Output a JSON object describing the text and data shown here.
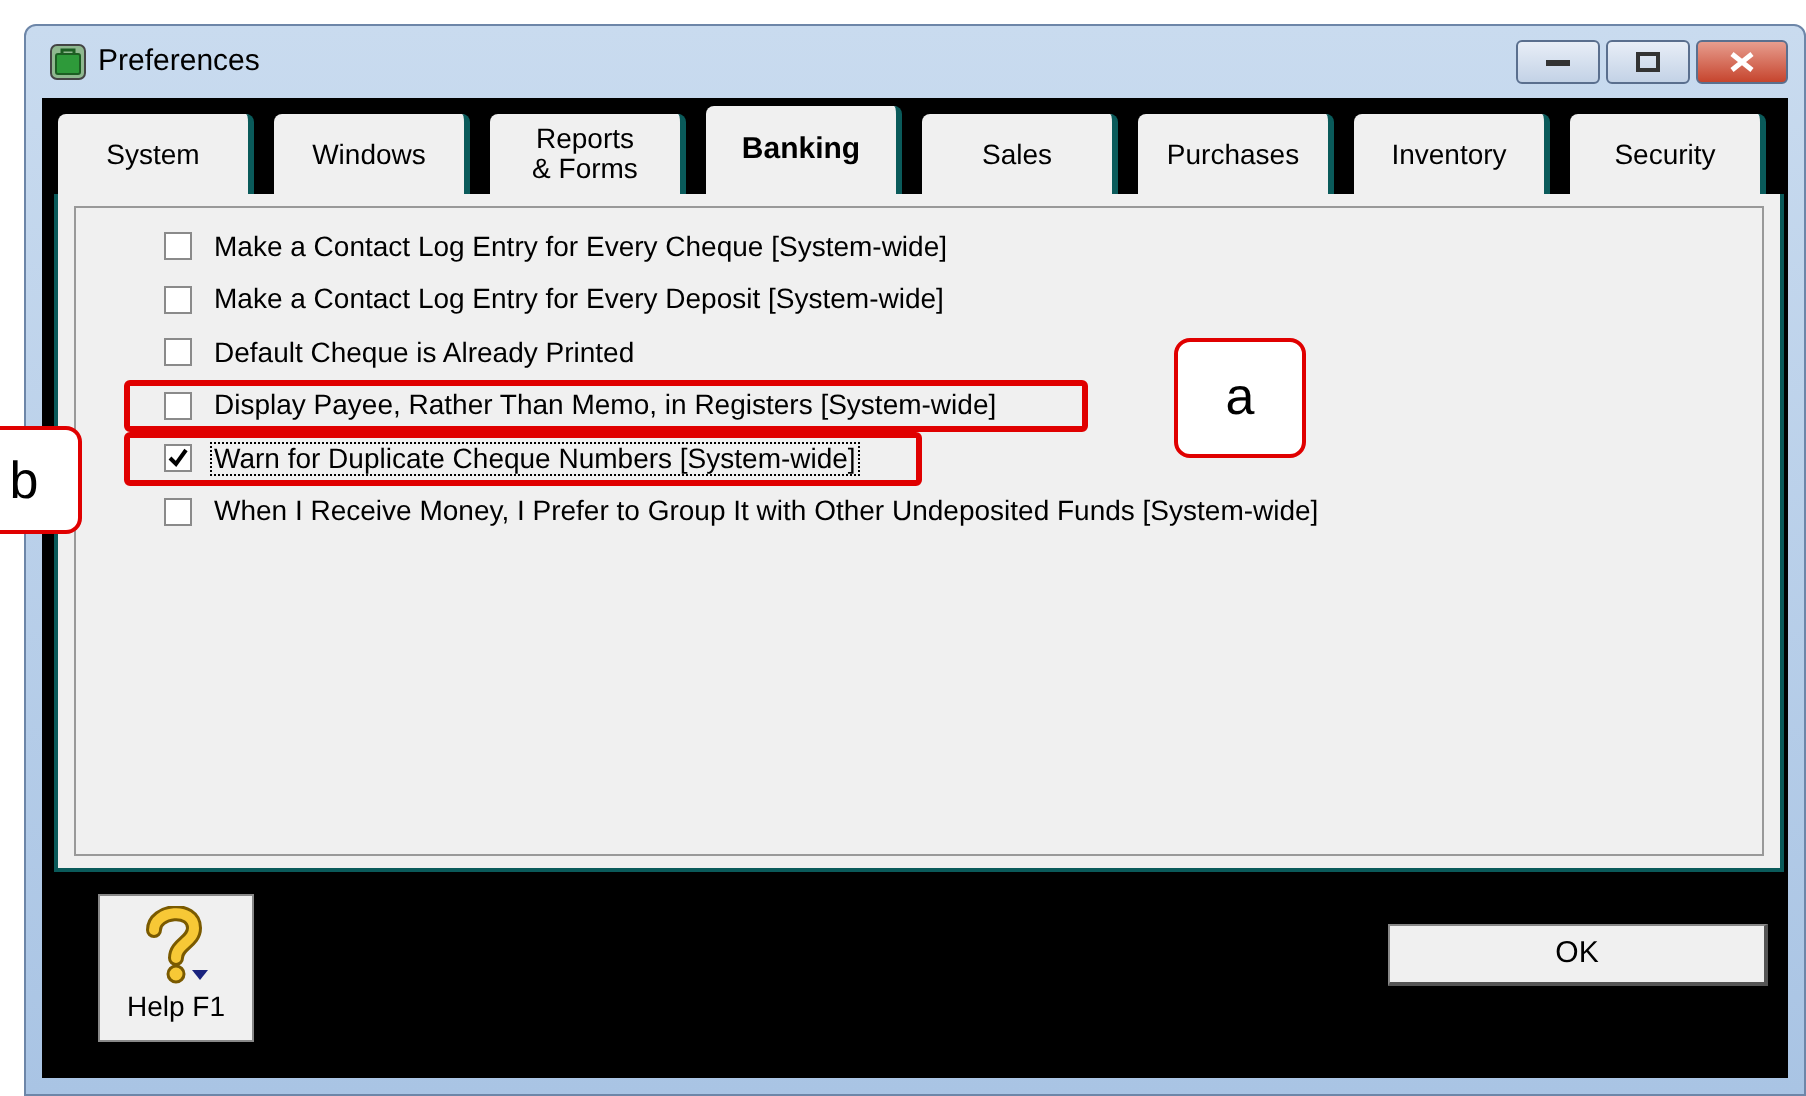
{
  "window": {
    "title": "Preferences"
  },
  "tabs": [
    {
      "label": "System",
      "selected": false
    },
    {
      "label": "Windows",
      "selected": false
    },
    {
      "label": "Reports\n& Forms",
      "selected": false
    },
    {
      "label": "Banking",
      "selected": true
    },
    {
      "label": "Sales",
      "selected": false
    },
    {
      "label": "Purchases",
      "selected": false
    },
    {
      "label": "Inventory",
      "selected": false
    },
    {
      "label": "Security",
      "selected": false
    }
  ],
  "options": [
    {
      "label": "Make a Contact Log Entry for Every Cheque [System-wide]",
      "checked": false
    },
    {
      "label": "Make a Contact Log Entry for Every Deposit [System-wide]",
      "checked": false
    },
    {
      "label": "Default Cheque is Already Printed",
      "checked": false
    },
    {
      "label": "Display Payee, Rather Than Memo, in Registers [System-wide]",
      "checked": false,
      "callout": "a"
    },
    {
      "label": "Warn for Duplicate Cheque Numbers [System-wide]",
      "checked": true,
      "focused": true,
      "callout": "b"
    },
    {
      "label": "When I Receive Money, I Prefer to Group It with Other Undeposited Funds [System-wide]",
      "checked": false
    }
  ],
  "buttons": {
    "help": "Help F1",
    "ok": "OK"
  }
}
